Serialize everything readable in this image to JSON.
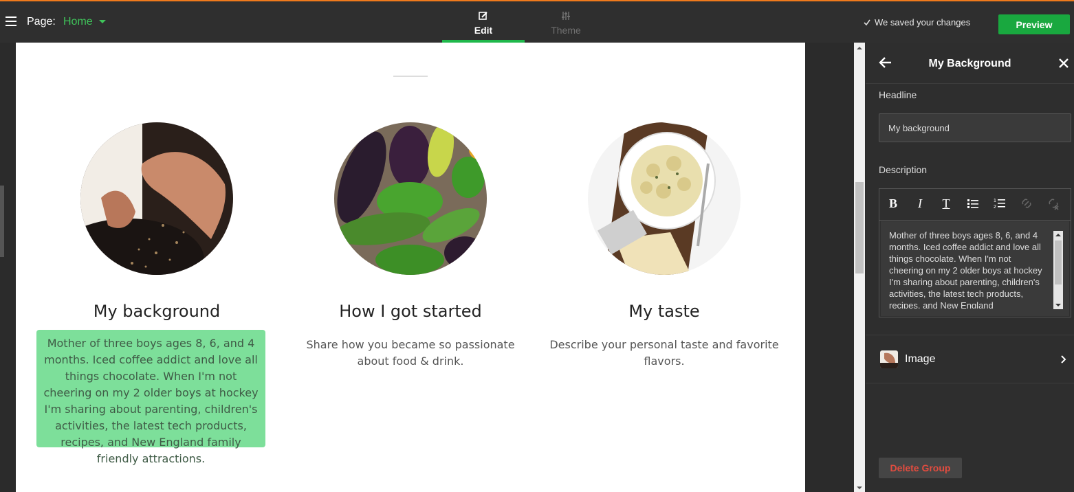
{
  "topbar": {
    "page_label": "Page:",
    "page_value": "Home",
    "tabs": [
      {
        "label": "Edit",
        "active": true
      },
      {
        "label": "Theme",
        "active": false
      }
    ],
    "saved_status": "We saved your changes",
    "preview_label": "Preview",
    "accent_color": "#f07a1c",
    "brand_green": "#19a83f"
  },
  "canvas": {
    "columns": [
      {
        "heading": "My background",
        "description": "Mother of three boys ages 8, 6, and 4 months. Iced coffee addict and love all things chocolate. When I'm not cheering on my 2 older boys at  hockey I'm sharing about parenting, children's activities, the latest  tech products, recipes, and New England family friendly attractions.",
        "image": "hands-sprinkling-spice-photo",
        "selected": true
      },
      {
        "heading": "How I got started",
        "description": "Share how you became so passionate about food & drink.",
        "image": "vegetables-photo"
      },
      {
        "heading": "My taste",
        "description": "Describe your personal taste and favorite flavors.",
        "image": "pasta-bowl-photo"
      }
    ],
    "highlight_color": "#7ddf9a"
  },
  "panel": {
    "title": "My Background",
    "headline_label": "Headline",
    "headline_value": "My background",
    "description_label": "Description",
    "toolbar": [
      "B",
      "I",
      "T",
      "bullet-list",
      "numbered-list",
      "link",
      "unlink"
    ],
    "description_value": "Mother of three boys ages 8, 6, and 4 months. Iced coffee addict and love all things chocolate. When I'm not cheering on my 2 older boys at hockey I'm sharing about parenting, children's activities, the latest  tech products, recipes, and New England",
    "image_label": "Image",
    "delete_label": "Delete Group"
  }
}
